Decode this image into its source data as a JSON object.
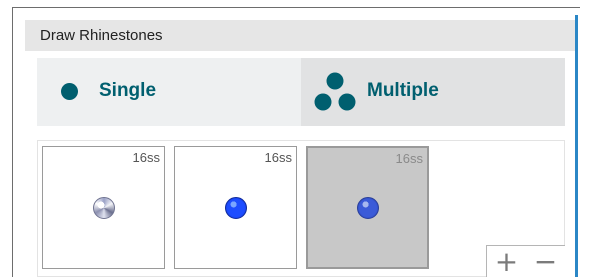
{
  "panel": {
    "title": "Draw Rhinestones",
    "colors": {
      "accent": "#005f6f",
      "header_bg": "#e6e6e6",
      "selection_bar": "#2b87c6"
    }
  },
  "modes": [
    {
      "label": "Single",
      "icon": "single-dot-icon",
      "selected": false
    },
    {
      "label": "Multiple",
      "icon": "three-dots-icon",
      "selected": true
    }
  ],
  "stones": [
    {
      "size": "16ss",
      "gem": "clear-crystal",
      "selected": false
    },
    {
      "size": "16ss",
      "gem": "blue",
      "selected": false
    },
    {
      "size": "16ss",
      "gem": "blue",
      "selected": true
    }
  ],
  "zoom": {
    "plus": "+",
    "minus": "−"
  }
}
